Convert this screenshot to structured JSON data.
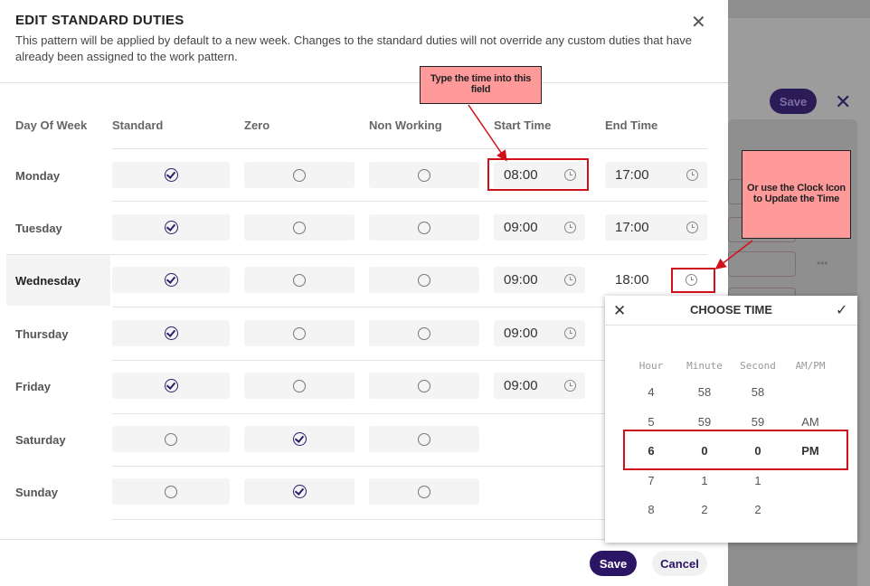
{
  "modal": {
    "title": "EDIT STANDARD DUTIES",
    "description": "This pattern will be applied by default to a new week. Changes to the standard duties will not override any custom duties that have already been assigned to the work pattern.",
    "close_icon": "close-icon",
    "columns": [
      "Day Of Week",
      "Standard",
      "Zero",
      "Non Working",
      "Start Time",
      "End Time"
    ],
    "rows": [
      {
        "day": "Monday",
        "selected": "standard",
        "start": "08:00",
        "end": "17:00"
      },
      {
        "day": "Tuesday",
        "selected": "standard",
        "start": "09:00",
        "end": "17:00"
      },
      {
        "day": "Wednesday",
        "selected": "standard",
        "start": "09:00",
        "end": "18:00"
      },
      {
        "day": "Thursday",
        "selected": "standard",
        "start": "09:00",
        "end": ""
      },
      {
        "day": "Friday",
        "selected": "standard",
        "start": "09:00",
        "end": ""
      },
      {
        "day": "Saturday",
        "selected": "zero",
        "start": "",
        "end": ""
      },
      {
        "day": "Sunday",
        "selected": "zero",
        "start": "",
        "end": ""
      }
    ],
    "save_label": "Save",
    "cancel_label": "Cancel"
  },
  "picker": {
    "title": "CHOOSE TIME",
    "headers": [
      "Hour",
      "Minute",
      "Second",
      "AM/PM"
    ],
    "hour": [
      "4",
      "5",
      "6",
      "7",
      "8"
    ],
    "minute": [
      "58",
      "59",
      "0",
      "1",
      "2"
    ],
    "second": [
      "58",
      "59",
      "0",
      "1",
      "2"
    ],
    "ampm": [
      "AM",
      "PM"
    ],
    "selected": {
      "hour": "6",
      "minute": "0",
      "second": "0",
      "ampm": "PM"
    }
  },
  "annotations": {
    "type_note": "Type the time into this field",
    "clock_note": "Or use the Clock Icon to Update the Time"
  },
  "background": {
    "save_label": "Save"
  },
  "colors": {
    "primary": "#2b1565",
    "annotation_fill": "#ff9a9a",
    "annotation_border": "#d0111b"
  }
}
